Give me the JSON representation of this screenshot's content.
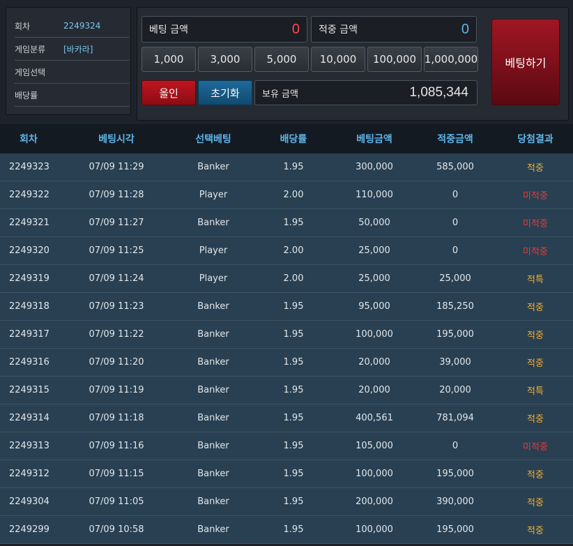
{
  "info": {
    "round_label": "회차",
    "round_value": "2249324",
    "category_label": "게임분류",
    "category_value": "[바카라]",
    "select_label": "게임선택",
    "odds_label": "배당률"
  },
  "bet": {
    "bet_amount_label": "베팅 금액",
    "bet_amount_value": "0",
    "win_amount_label": "적중 금액",
    "win_amount_value": "0",
    "chips": [
      "1,000",
      "3,000",
      "5,000",
      "10,000",
      "100,000",
      "1,000,000"
    ],
    "allin_label": "올인",
    "reset_label": "초기화",
    "balance_label": "보유 금액",
    "balance_value": "1,085,344",
    "bet_button_label": "베팅하기"
  },
  "colors": {
    "bet_amount": "#ff4a4a",
    "win_amount": "#5fb4e8",
    "win_result": "#f0b038",
    "lose_result": "#e83a3a"
  },
  "table": {
    "headers": [
      "회차",
      "베팅시각",
      "선택베팅",
      "배당률",
      "베팅금액",
      "적중금액",
      "당첨결과"
    ],
    "rows": [
      [
        "2249323",
        "07/09 11:29",
        "Banker",
        "1.95",
        "300,000",
        "585,000",
        "적중"
      ],
      [
        "2249322",
        "07/09 11:28",
        "Player",
        "2.00",
        "110,000",
        "0",
        "미적중"
      ],
      [
        "2249321",
        "07/09 11:27",
        "Banker",
        "1.95",
        "50,000",
        "0",
        "미적중"
      ],
      [
        "2249320",
        "07/09 11:25",
        "Player",
        "2.00",
        "25,000",
        "0",
        "미적중"
      ],
      [
        "2249319",
        "07/09 11:24",
        "Player",
        "2.00",
        "25,000",
        "25,000",
        "적특"
      ],
      [
        "2249318",
        "07/09 11:23",
        "Banker",
        "1.95",
        "95,000",
        "185,250",
        "적중"
      ],
      [
        "2249317",
        "07/09 11:22",
        "Banker",
        "1.95",
        "100,000",
        "195,000",
        "적중"
      ],
      [
        "2249316",
        "07/09 11:20",
        "Banker",
        "1.95",
        "20,000",
        "39,000",
        "적중"
      ],
      [
        "2249315",
        "07/09 11:19",
        "Banker",
        "1.95",
        "20,000",
        "20,000",
        "적특"
      ],
      [
        "2249314",
        "07/09 11:18",
        "Banker",
        "1.95",
        "400,561",
        "781,094",
        "적중"
      ],
      [
        "2249313",
        "07/09 11:16",
        "Banker",
        "1.95",
        "105,000",
        "0",
        "미적중"
      ],
      [
        "2249312",
        "07/09 11:15",
        "Banker",
        "1.95",
        "100,000",
        "195,000",
        "적중"
      ],
      [
        "2249304",
        "07/09 11:05",
        "Banker",
        "1.95",
        "200,000",
        "390,000",
        "적중"
      ],
      [
        "2249299",
        "07/09 10:58",
        "Banker",
        "1.95",
        "100,000",
        "195,000",
        "적중"
      ]
    ]
  }
}
